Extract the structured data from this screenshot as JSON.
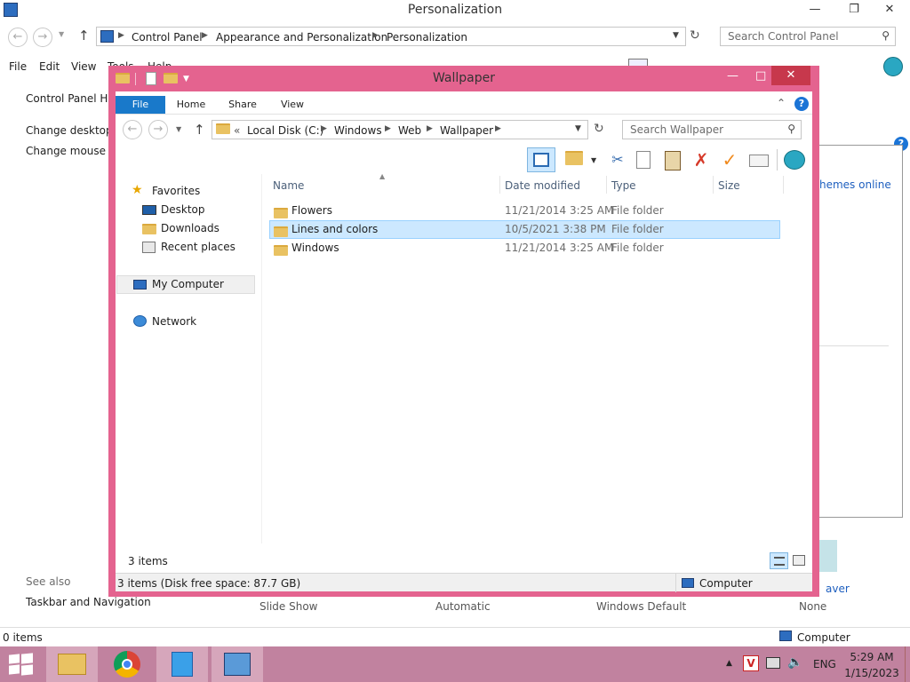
{
  "back_window": {
    "title": "Personalization",
    "breadcrumb": [
      "Control Panel",
      "Appearance and Personalization",
      "Personalization"
    ],
    "search_placeholder": "Search Control Panel",
    "menu": [
      "File",
      "Edit",
      "View",
      "Tools",
      "Help"
    ],
    "sidebar": {
      "home": "Control Panel Ho",
      "link1": "Change desktop i",
      "link2": "Change mouse po",
      "see_also": "See also",
      "taskbar_link": "Taskbar and Navigation"
    },
    "themes_online": "hemes online",
    "bottom_labels": [
      "Slide Show",
      "Automatic",
      "Windows Default",
      "None"
    ],
    "saver_label": "aver",
    "status_items": "0 items",
    "status_computer": "Computer"
  },
  "wallpaper_window": {
    "title": "Wallpaper",
    "ribbon_tabs": [
      "File",
      "Home",
      "Share",
      "View"
    ],
    "address": {
      "prefix": "«",
      "crumbs": [
        "Local Disk (C:)",
        "Windows",
        "Web",
        "Wallpaper"
      ]
    },
    "search_placeholder": "Search Wallpaper",
    "nav": {
      "favorites": "Favorites",
      "desktop": "Desktop",
      "downloads": "Downloads",
      "recent": "Recent places",
      "my_computer": "My Computer",
      "network": "Network"
    },
    "columns": [
      "Name",
      "Date modified",
      "Type",
      "Size"
    ],
    "rows": [
      {
        "name": "Flowers",
        "date": "11/21/2014 3:25 AM",
        "type": "File folder",
        "size": ""
      },
      {
        "name": "Lines and colors",
        "date": "10/5/2021 3:38 PM",
        "type": "File folder",
        "size": ""
      },
      {
        "name": "Windows",
        "date": "11/21/2014 3:25 AM",
        "type": "File folder",
        "size": ""
      }
    ],
    "selected_row": 1,
    "item_count": "3 items",
    "status_details": "3 items (Disk free space: 87.7 GB)",
    "status_location": "Computer"
  },
  "taskbar": {
    "language": "ENG",
    "time": "5:29 AM",
    "date": "1/15/2023"
  },
  "colors": {
    "window_frame": "#e4638f",
    "taskbar": "#c1829f",
    "file_tab": "#1979ca",
    "selection": "#cce8ff"
  }
}
